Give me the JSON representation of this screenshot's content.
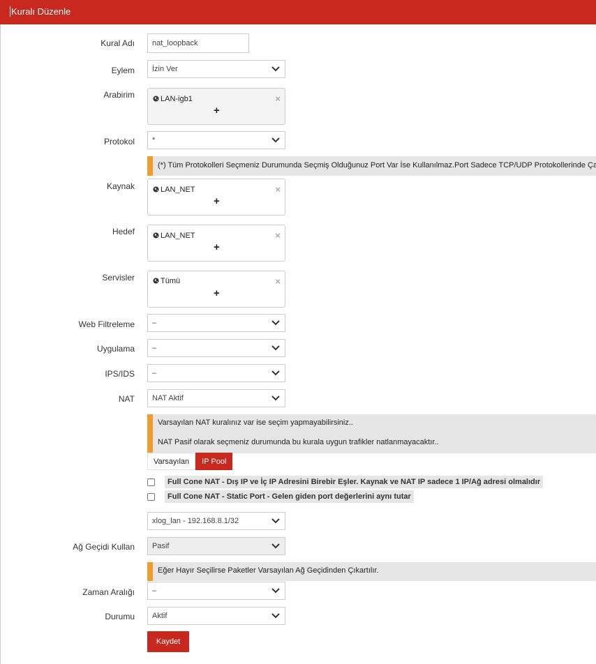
{
  "header": {
    "title": "Kuralı Düzenle"
  },
  "form": {
    "rule_name": {
      "label": "Kural Adı",
      "value": "nat_loopback"
    },
    "action": {
      "label": "Eylem",
      "value": "İzin Ver"
    },
    "interface": {
      "label": "Arabirim",
      "tag": "LAN-igb1"
    },
    "protocol": {
      "label": "Protokol",
      "value": "*"
    },
    "protocol_note": "(*) Tüm Protokolleri Seçmeniz Durumunda Seçmiş Olduğunuz Port Var İse Kullanılmaz.Port Sadece TCP/UDP Protokollerinde Çalışır",
    "source": {
      "label": "Kaynak",
      "tag": "LAN_NET"
    },
    "destination": {
      "label": "Hedef",
      "tag": "LAN_NET"
    },
    "services": {
      "label": "Servisler",
      "tag": "Tümü"
    },
    "web_filter": {
      "label": "Web Filtreleme",
      "value": "–"
    },
    "application": {
      "label": "Uygulama",
      "value": "–"
    },
    "ips_ids": {
      "label": "IPS/IDS",
      "value": "–"
    },
    "nat": {
      "label": "NAT",
      "value": "NAT Aktif"
    },
    "nat_notes": [
      "Varsayılan NAT kuralınız var ise seçim yapmayabilirsiniz..",
      "NAT Pasif olarak seçmeniz durumunda bu kurala uygun trafikler natlanmayacaktır.."
    ],
    "nat_tabs": [
      {
        "label": "Varsayılan",
        "active": false
      },
      {
        "label": "IP Pool",
        "active": true
      }
    ],
    "full_cone": {
      "label": "Full Cone NAT - Dış IP ve İç IP Adresini Birebir Eşler. Kaynak ve NAT IP sadece 1 IP/Ağ adresi olmalıdır",
      "checked": false
    },
    "static_port": {
      "label": "Full Cone NAT - Static Port - Gelen giden port değerlerini aynı tutar",
      "checked": false
    },
    "ip_pool": {
      "value": "xlog_lan - 192.168.8.1/32"
    },
    "gateway": {
      "label": "Ağ Geçidi Kullan",
      "value": "Pasif"
    },
    "gateway_note": "Eğer Hayır Seçilirse Paketler Varsayılan Ağ Geçidinden Çıkartılır.",
    "time_range": {
      "label": "Zaman Aralığı",
      "value": "–"
    },
    "status": {
      "label": "Durumu",
      "value": "Aktif"
    },
    "save_label": "Kaydet"
  },
  "colors": {
    "accent": "#c8281e",
    "note_bar": "#f29b2f",
    "note_bg": "#e6e6e6"
  },
  "icons": [
    "globe-icon",
    "remove-icon",
    "plus-icon",
    "chevron-down-icon"
  ]
}
